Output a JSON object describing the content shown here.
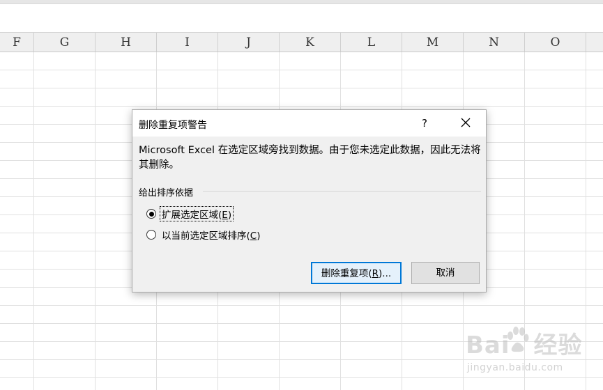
{
  "spreadsheet": {
    "columns": [
      {
        "label": "F"
      },
      {
        "label": "G"
      },
      {
        "label": "H"
      },
      {
        "label": "I"
      },
      {
        "label": "J"
      },
      {
        "label": "K"
      },
      {
        "label": "L"
      },
      {
        "label": "M"
      },
      {
        "label": "N"
      },
      {
        "label": "O"
      }
    ]
  },
  "dialog": {
    "title": "删除重复项警告",
    "help_label": "?",
    "close_icon": "close-icon",
    "message": "Microsoft Excel 在选定区域旁找到数据。由于您未选定此数据，因此无法将其删除。",
    "group_label": "给出排序依据",
    "options": [
      {
        "text": "扩展选定区域(",
        "accel": "E",
        "tail": ")",
        "checked": true
      },
      {
        "text": "以当前选定区域排序(",
        "accel": "C",
        "tail": ")",
        "checked": false
      }
    ],
    "primary_button": {
      "text": "删除重复项(",
      "accel": "R",
      "tail": ")..."
    },
    "cancel_button": "取消"
  },
  "watermark": {
    "brand": "Bai",
    "brand_tail": "经验",
    "url": "jingyan.baidu.com"
  }
}
